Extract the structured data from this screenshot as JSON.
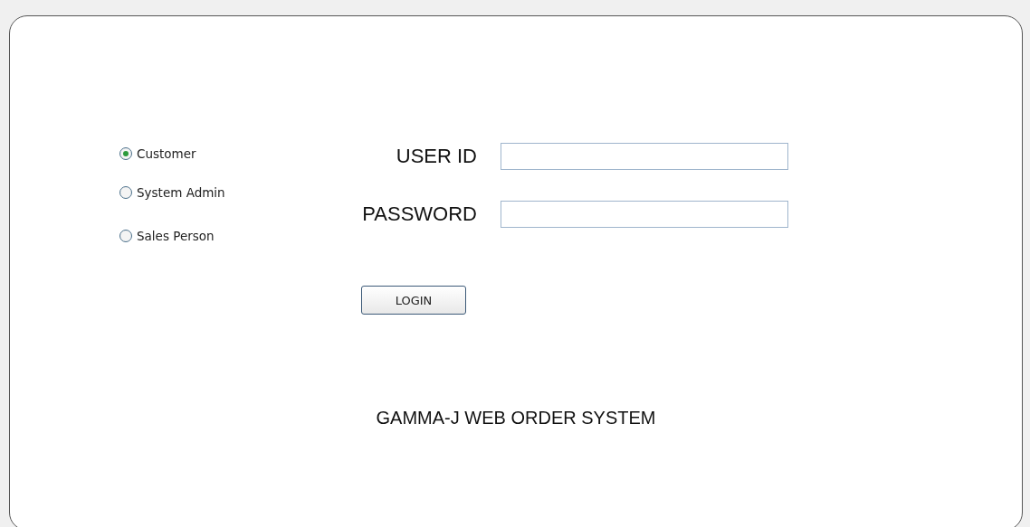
{
  "roles": [
    {
      "label": "Customer",
      "selected": true
    },
    {
      "label": "System Admin",
      "selected": false
    },
    {
      "label": "Sales Person",
      "selected": false
    }
  ],
  "fields": [
    {
      "label": "USER ID"
    },
    {
      "label": "PASSWORD"
    }
  ],
  "login_button": "LOGIN",
  "footer": "GAMMA-J WEB ORDER SYSTEM"
}
